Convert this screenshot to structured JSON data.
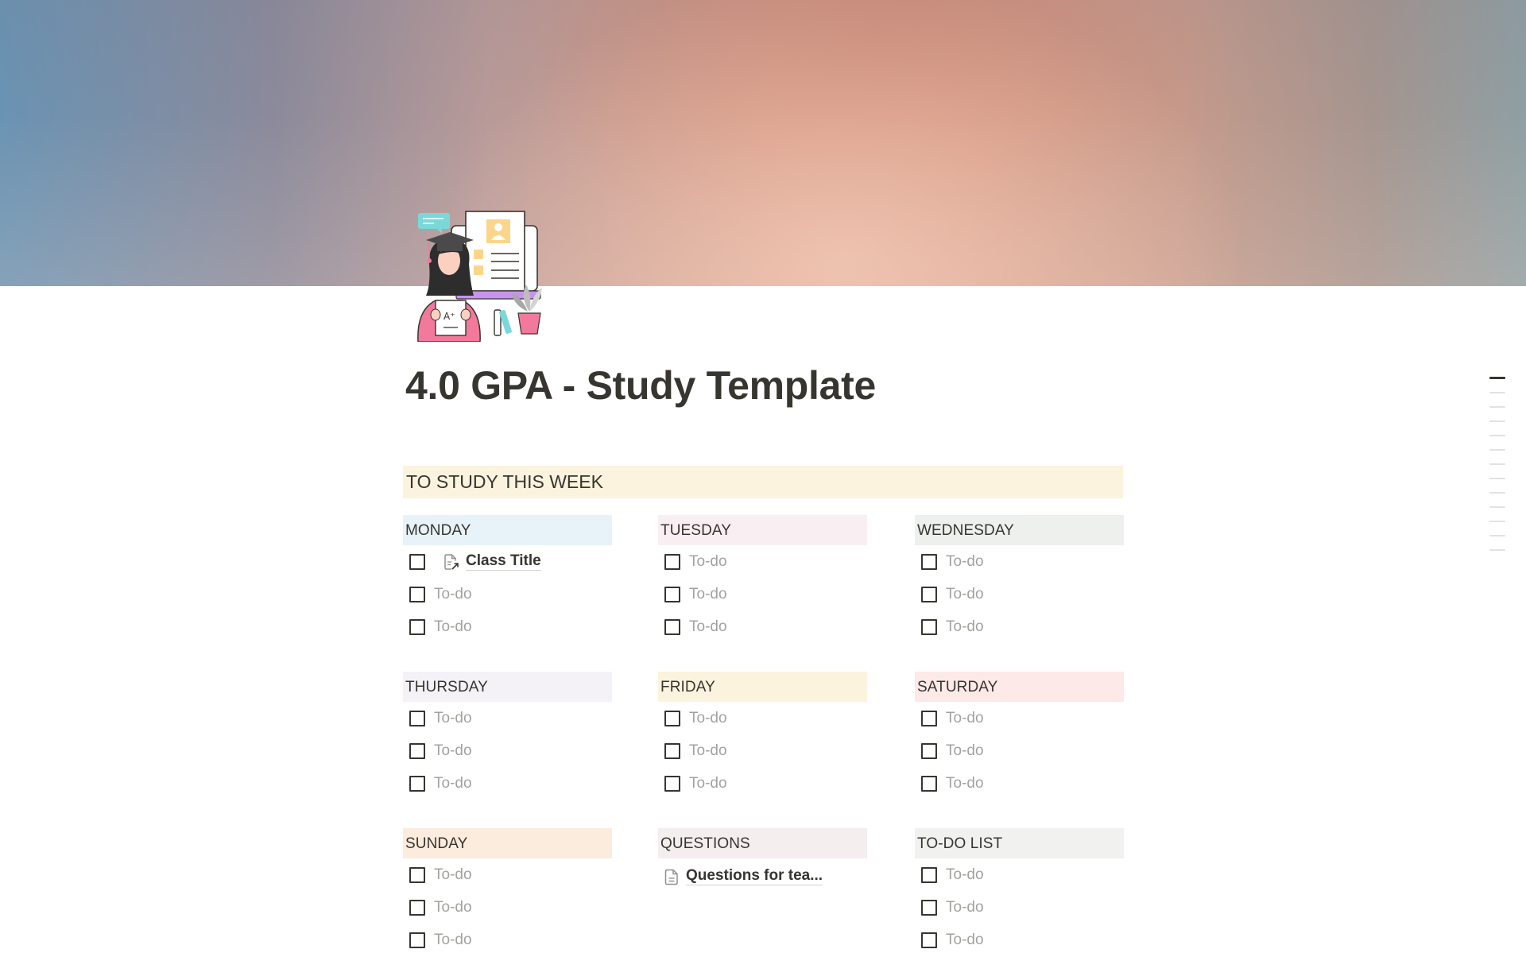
{
  "page": {
    "title": "4.0 GPA - Study Template",
    "icon": "graduate-student-illustration"
  },
  "section": {
    "heading": "TO STUDY THIS WEEK",
    "color": "#fbf3de"
  },
  "columns": [
    {
      "key": "monday",
      "label": "MONDAY",
      "color": "#e7f3f8",
      "items": [
        {
          "type": "page-link",
          "text": "Class Title",
          "icon": "page-link-icon",
          "checked": false
        },
        {
          "type": "todo",
          "text": "To-do",
          "checked": false
        },
        {
          "type": "todo",
          "text": "To-do",
          "checked": false
        }
      ]
    },
    {
      "key": "tuesday",
      "label": "TUESDAY",
      "color": "#f9eff3",
      "items": [
        {
          "type": "todo",
          "text": "To-do",
          "checked": false
        },
        {
          "type": "todo",
          "text": "To-do",
          "checked": false
        },
        {
          "type": "todo",
          "text": "To-do",
          "checked": false
        }
      ]
    },
    {
      "key": "wednesday",
      "label": "WEDNESDAY",
      "color": "#edf0ec",
      "items": [
        {
          "type": "todo",
          "text": "To-do",
          "checked": false
        },
        {
          "type": "todo",
          "text": "To-do",
          "checked": false
        },
        {
          "type": "todo",
          "text": "To-do",
          "checked": false
        }
      ]
    },
    {
      "key": "thursday",
      "label": "THURSDAY",
      "color": "#f4f2f7",
      "items": [
        {
          "type": "todo",
          "text": "To-do",
          "checked": false
        },
        {
          "type": "todo",
          "text": "To-do",
          "checked": false
        },
        {
          "type": "todo",
          "text": "To-do",
          "checked": false
        }
      ]
    },
    {
      "key": "friday",
      "label": "FRIDAY",
      "color": "#fbf3de",
      "items": [
        {
          "type": "todo",
          "text": "To-do",
          "checked": false
        },
        {
          "type": "todo",
          "text": "To-do",
          "checked": false
        },
        {
          "type": "todo",
          "text": "To-do",
          "checked": false
        }
      ]
    },
    {
      "key": "saturday",
      "label": "SATURDAY",
      "color": "#fce9e8",
      "items": [
        {
          "type": "todo",
          "text": "To-do",
          "checked": false
        },
        {
          "type": "todo",
          "text": "To-do",
          "checked": false
        },
        {
          "type": "todo",
          "text": "To-do",
          "checked": false
        }
      ]
    },
    {
      "key": "sunday",
      "label": "SUNDAY",
      "color": "#fbecdd",
      "items": [
        {
          "type": "todo",
          "text": "To-do",
          "checked": false
        },
        {
          "type": "todo",
          "text": "To-do",
          "checked": false
        },
        {
          "type": "todo",
          "text": "To-do",
          "checked": false
        }
      ]
    },
    {
      "key": "questions",
      "label": "QUESTIONS",
      "color": "#f4eeee",
      "items": [
        {
          "type": "page",
          "text": "Questions for tea...",
          "icon": "page-icon"
        }
      ]
    },
    {
      "key": "todo_list",
      "label": "TO-DO LIST",
      "color": "#f1f1ef",
      "items": [
        {
          "type": "todo",
          "text": "To-do",
          "checked": false
        },
        {
          "type": "todo",
          "text": "To-do",
          "checked": false
        },
        {
          "type": "todo",
          "text": "To-do",
          "checked": false
        }
      ]
    }
  ],
  "toc": {
    "count": 13,
    "active_index": 0
  }
}
